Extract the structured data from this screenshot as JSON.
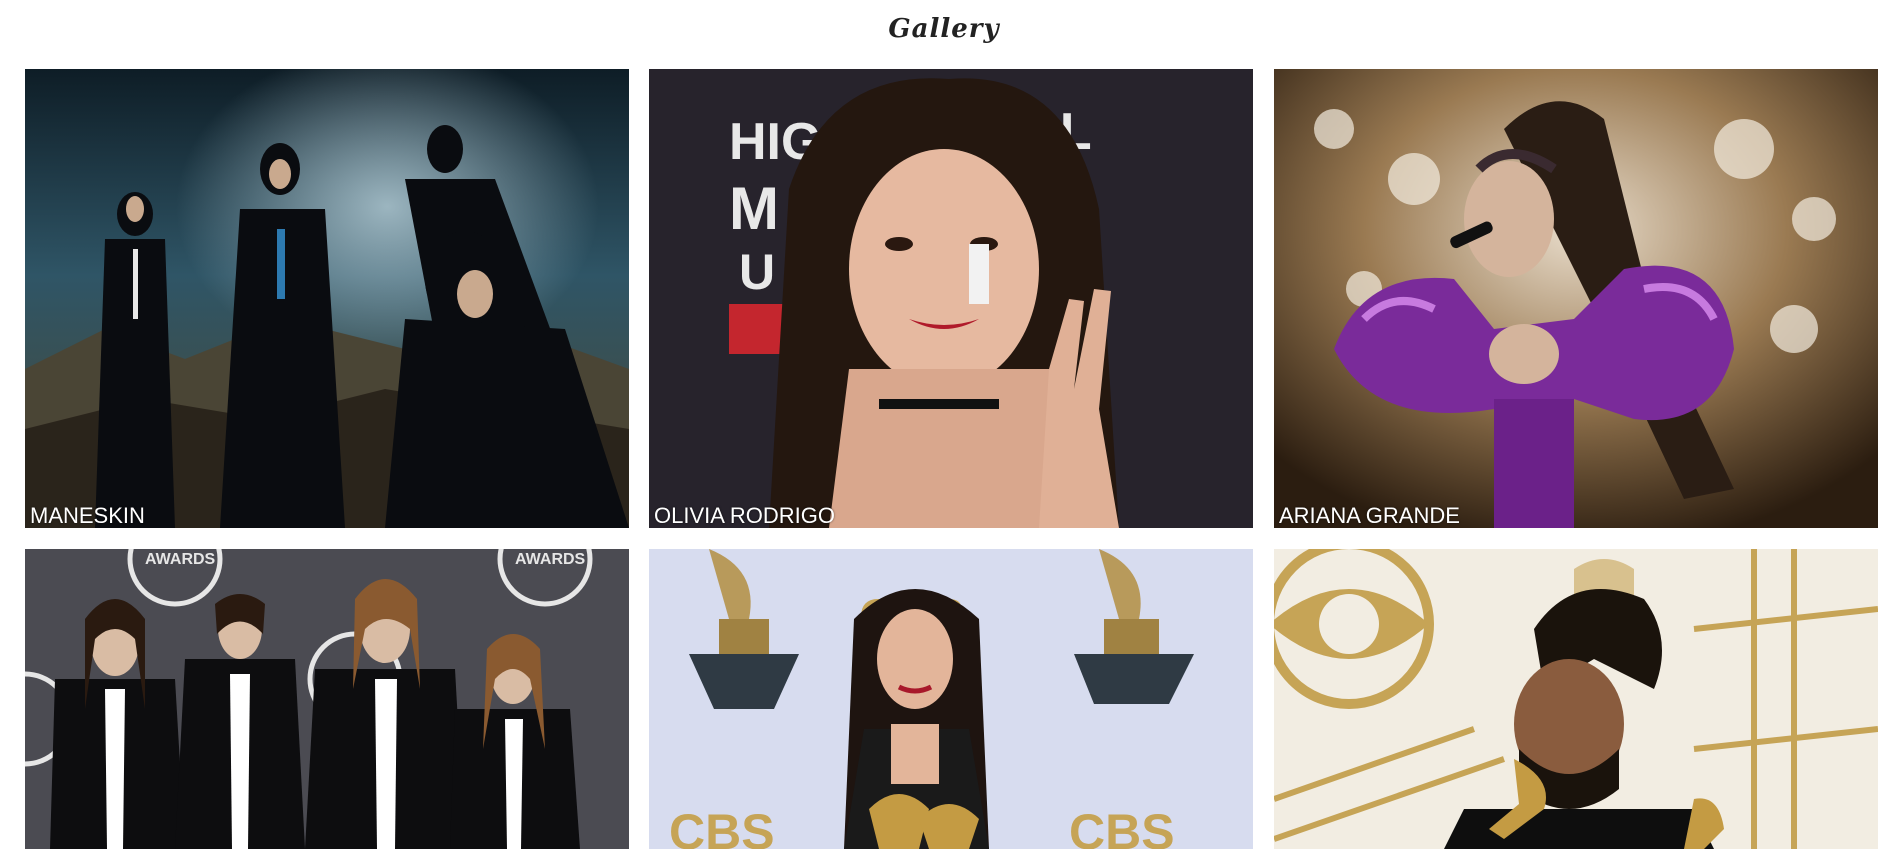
{
  "page": {
    "title": "Gallery"
  },
  "gallery": {
    "items": [
      {
        "caption": "MANESKIN"
      },
      {
        "caption": "OLIVIA RODRIGO"
      },
      {
        "caption": "ARIANA GRANDE"
      },
      {
        "caption": ""
      },
      {
        "caption": ""
      },
      {
        "caption": ""
      }
    ]
  }
}
